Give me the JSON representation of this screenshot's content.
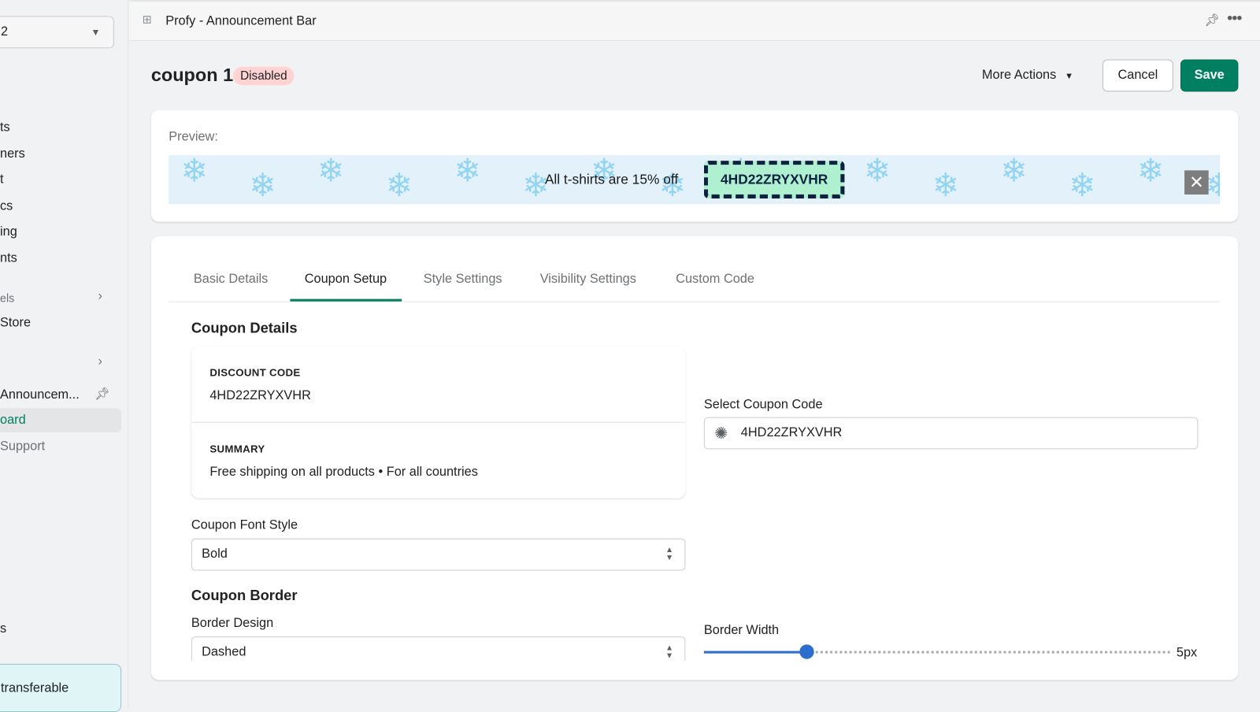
{
  "sidebar": {
    "store_select": "2",
    "items": [
      "ts",
      "ners",
      "t",
      "cs",
      "ing",
      "nts"
    ],
    "section1": "els",
    "online_store": "Store",
    "app_item": "Announcem...",
    "app_subitems": [
      "oard",
      "Support"
    ],
    "bottom_item": "s",
    "banner": "transferable"
  },
  "topbar": {
    "title": "Profy - Announcement Bar"
  },
  "header": {
    "title": "coupon 1",
    "status": "Disabled",
    "more_actions": "More Actions",
    "cancel": "Cancel",
    "save": "Save"
  },
  "preview": {
    "label": "Preview:",
    "text": "All t-shirts are 15% off",
    "code": "4HD22ZRYXVHR",
    "bg_color": "#e3f1fa",
    "code_bg": "#aef0cf"
  },
  "tabs": [
    "Basic Details",
    "Coupon Setup",
    "Style Settings",
    "Visibility Settings",
    "Custom Code"
  ],
  "active_tab": "Coupon Setup",
  "coupon": {
    "section": "Coupon Details",
    "discount_code_label": "DISCOUNT CODE",
    "discount_code": "4HD22ZRYXVHR",
    "summary_label": "SUMMARY",
    "summary": "Free shipping on all products • For all countries",
    "select_label": "Select Coupon Code",
    "select_value": "4HD22ZRYXVHR",
    "font_style_label": "Coupon Font Style",
    "font_style": "Bold"
  },
  "border": {
    "section": "Coupon Border",
    "design_label": "Border Design",
    "design": "Dashed",
    "width_label": "Border Width",
    "width_value": "5px",
    "width_fraction": 0.22
  },
  "colors": {
    "accent": "#008060",
    "slider": "#2c6ecb"
  }
}
